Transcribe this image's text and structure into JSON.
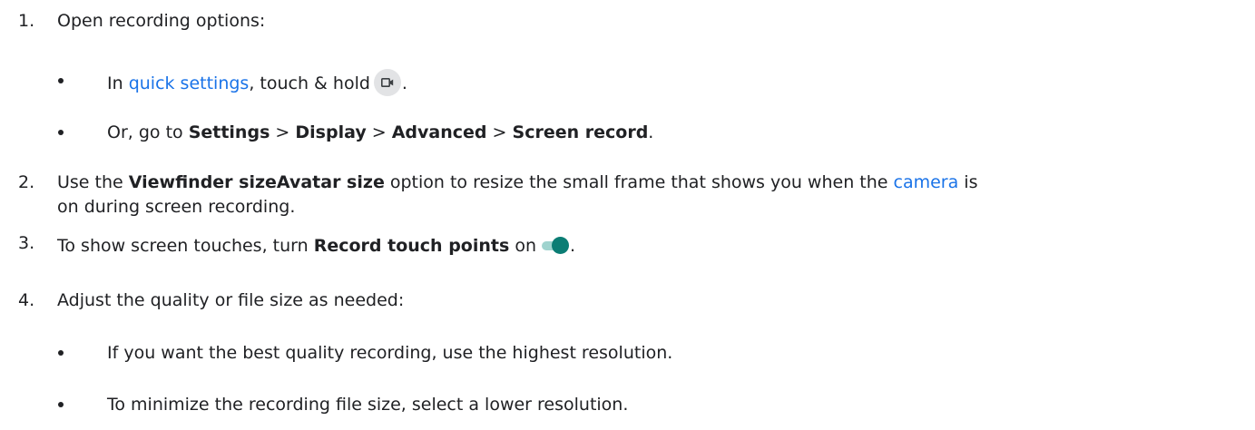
{
  "steps": [
    {
      "number": "1.",
      "text": "Open recording options:",
      "bullets": [
        {
          "prefix": "In ",
          "link": "quick settings",
          "middle": ", touch & hold",
          "icon": "screen-record-camera-icon",
          "suffix": "."
        },
        {
          "prefix": "Or, go to ",
          "settings": "Settings",
          "sep1": " > ",
          "display": "Display",
          "sep2": " > ",
          "advanced": "Advanced",
          "sep3": " > ",
          "screen_record": "Screen record",
          "suffix": "."
        }
      ]
    },
    {
      "number": "2.",
      "prefix": "Use the ",
      "bold": "Viewfinder sizeAvatar size",
      "middle": " option to resize the small frame that shows you when the ",
      "link": "camera",
      "suffix": " is",
      "line2": "on during screen recording."
    },
    {
      "number": "3.",
      "prefix": "To show screen touches, turn ",
      "bold": "Record touch points",
      "middle": " on",
      "icon": "toggle-on-icon",
      "suffix": "."
    },
    {
      "number": "4.",
      "text": "Adjust the quality or file size as needed:",
      "bullets": [
        {
          "text": "If you want the best quality recording, use the highest resolution."
        },
        {
          "text": "To minimize the recording file size, select a lower resolution."
        }
      ]
    }
  ],
  "colors": {
    "text": "#202124",
    "link": "#1a73e8",
    "toggle_thumb": "#0b7d74",
    "toggle_track": "#9fd3ce",
    "icon_bg": "#e2e3e5"
  }
}
